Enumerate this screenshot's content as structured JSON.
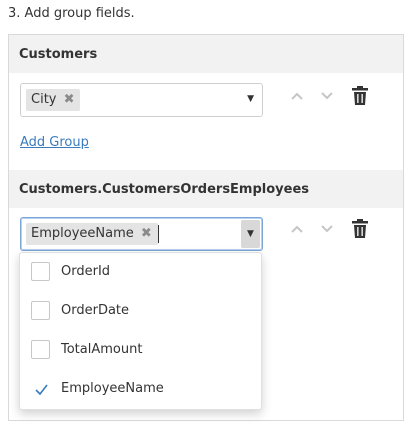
{
  "instruction": "3. Add group fields.",
  "groups": [
    {
      "title": "Customers",
      "tags": [
        "City"
      ],
      "tag_remove_glyph": "✖",
      "add_group_label": "Add Group"
    },
    {
      "title": "Customers.CustomersOrdersEmployees",
      "tags": [
        "EmployeeName"
      ],
      "tag_remove_glyph": "✖"
    }
  ],
  "dropdown": {
    "options": [
      {
        "label": "OrderId",
        "checked": false
      },
      {
        "label": "OrderDate",
        "checked": false
      },
      {
        "label": "TotalAmount",
        "checked": false
      },
      {
        "label": "EmployeeName",
        "checked": true
      }
    ]
  },
  "icons": {
    "up": "chevron-up-icon",
    "down": "chevron-down-icon",
    "delete": "trash-icon",
    "dropdown": "caret-down-icon"
  },
  "colors": {
    "link": "#3a7bbf",
    "header_bg": "#f2f2f2",
    "check": "#3a7bbf"
  }
}
